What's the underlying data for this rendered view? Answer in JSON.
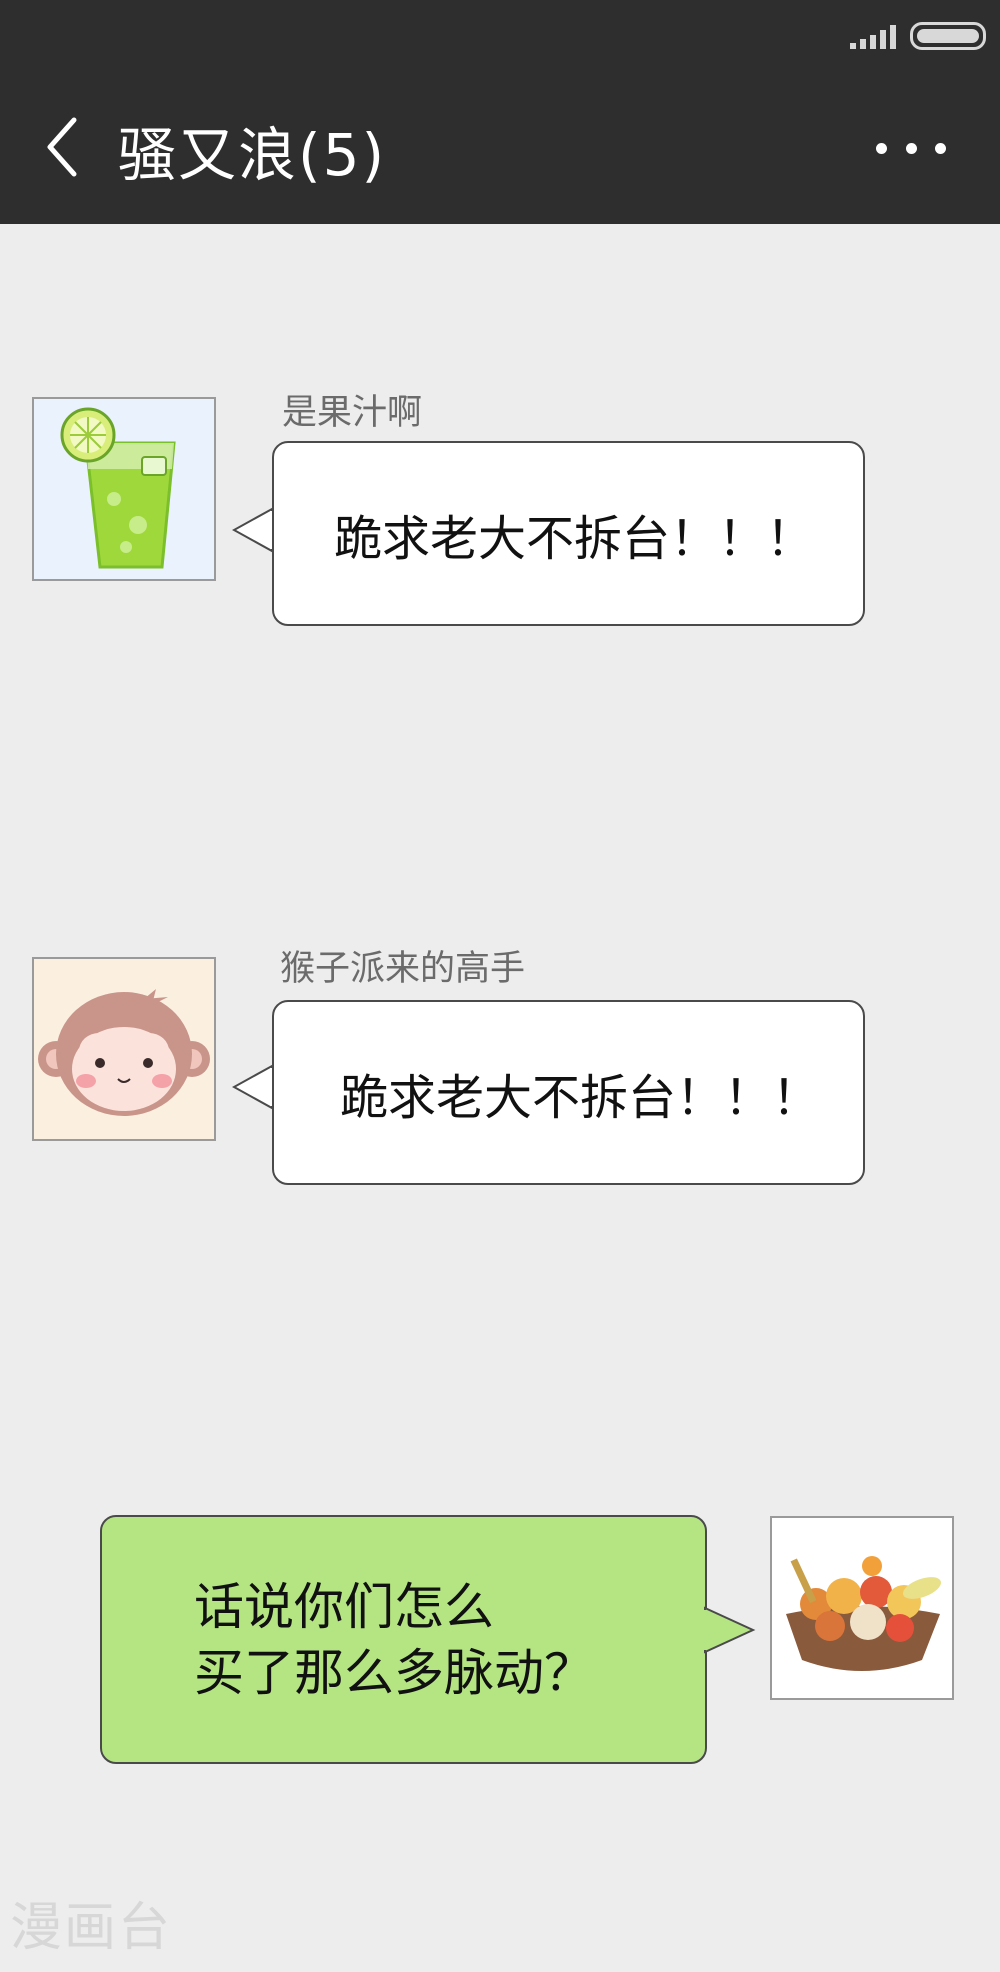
{
  "chat": {
    "title": "骚又浪(5)",
    "back_icon": "chevron-left-icon",
    "more_icon": "more-dots-icon"
  },
  "messages": [
    {
      "sender": "是果汁啊",
      "text": "跪求老大不拆台！！！",
      "avatar": "juice-cup-avatar",
      "side": "left"
    },
    {
      "sender": "猴子派来的高手",
      "text": "跪求老大不拆台！！！",
      "avatar": "monkey-avatar",
      "side": "left"
    },
    {
      "sender": "",
      "text_line1": "话说你们怎么",
      "text_line2": "买了那么多脉动？",
      "avatar": "fruit-bowl-avatar",
      "side": "right"
    }
  ],
  "watermark": "漫画台",
  "colors": {
    "topbar": "#2e2e2e",
    "background": "#ededed",
    "self_bubble": "#b5e482",
    "other_bubble": "#ffffff"
  }
}
